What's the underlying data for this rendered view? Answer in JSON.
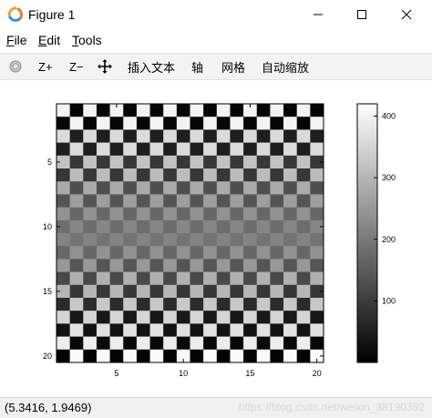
{
  "window": {
    "title": "Figure 1"
  },
  "menu": {
    "file": {
      "mnemonic": "F",
      "rest": "ile"
    },
    "edit": {
      "mnemonic": "E",
      "rest": "dit"
    },
    "tools": {
      "mnemonic": "T",
      "rest": "ools"
    }
  },
  "toolbar": {
    "zoom_in": "Z+",
    "zoom_out": "Z−",
    "insert_text": "插入文本",
    "axes": "轴",
    "grid": "网格",
    "autoscale": "自动缩放"
  },
  "status": {
    "coords": "(5.3416, 1.9469)",
    "watermark": "https://blog.csdn.net/weixin_38190382"
  },
  "colors": {
    "toolbar_bg": "#f3f3f3",
    "status_bg": "#f0f0f0"
  },
  "icons": [
    "octave-logo-icon",
    "minimize-icon",
    "maximize-icon",
    "close-icon",
    "rotate-icon",
    "pan-icon"
  ],
  "chart_data": {
    "type": "heatmap",
    "colormap": "gray",
    "title": "",
    "xlabel": "",
    "ylabel": "",
    "xlim": [
      0.5,
      20.5
    ],
    "ylim": [
      0.5,
      20.5
    ],
    "y_reversed": true,
    "x_ticks": [
      5,
      10,
      15,
      20
    ],
    "y_ticks": [
      5,
      10,
      15,
      20
    ],
    "colorbar": {
      "range": [
        0,
        420
      ],
      "ticks": [
        100,
        200,
        300,
        400
      ]
    },
    "grid": false,
    "values": [
      [
        400,
        10,
        400,
        10,
        400,
        10,
        400,
        10,
        400,
        10,
        400,
        10,
        400,
        10,
        400,
        10,
        400,
        10,
        400,
        10
      ],
      [
        10,
        400,
        10,
        400,
        10,
        400,
        10,
        400,
        10,
        400,
        10,
        400,
        10,
        400,
        10,
        400,
        10,
        400,
        10,
        400
      ],
      [
        360,
        50,
        360,
        50,
        360,
        50,
        360,
        50,
        360,
        50,
        360,
        50,
        360,
        50,
        360,
        50,
        360,
        50,
        360,
        50
      ],
      [
        50,
        360,
        50,
        360,
        50,
        360,
        50,
        360,
        50,
        360,
        50,
        360,
        50,
        360,
        50,
        360,
        50,
        360,
        50,
        360
      ],
      [
        320,
        90,
        320,
        90,
        320,
        90,
        320,
        90,
        320,
        90,
        320,
        90,
        320,
        90,
        320,
        90,
        320,
        90,
        320,
        90
      ],
      [
        90,
        310,
        90,
        310,
        90,
        310,
        90,
        310,
        90,
        310,
        90,
        310,
        90,
        310,
        90,
        310,
        90,
        310,
        90,
        310
      ],
      [
        280,
        130,
        280,
        130,
        280,
        130,
        280,
        130,
        280,
        130,
        280,
        130,
        280,
        130,
        280,
        130,
        280,
        130,
        280,
        130
      ],
      [
        140,
        260,
        140,
        260,
        140,
        260,
        140,
        260,
        140,
        260,
        140,
        260,
        140,
        260,
        140,
        260,
        140,
        260,
        140,
        260
      ],
      [
        240,
        170,
        240,
        170,
        240,
        170,
        240,
        170,
        240,
        170,
        240,
        170,
        240,
        170,
        240,
        170,
        240,
        170,
        240,
        170
      ],
      [
        180,
        220,
        180,
        220,
        180,
        220,
        180,
        220,
        180,
        220,
        180,
        220,
        180,
        220,
        180,
        220,
        180,
        220,
        180,
        220
      ],
      [
        215,
        190,
        215,
        190,
        215,
        190,
        215,
        190,
        215,
        190,
        215,
        190,
        215,
        190,
        215,
        190,
        215,
        190,
        215,
        190
      ],
      [
        170,
        240,
        170,
        240,
        170,
        240,
        170,
        240,
        170,
        240,
        170,
        240,
        170,
        240,
        170,
        240,
        170,
        240,
        170,
        240
      ],
      [
        250,
        140,
        250,
        140,
        250,
        140,
        250,
        140,
        250,
        140,
        250,
        140,
        250,
        140,
        250,
        140,
        250,
        140,
        250,
        140
      ],
      [
        120,
        290,
        120,
        290,
        120,
        290,
        120,
        290,
        120,
        290,
        120,
        290,
        120,
        290,
        120,
        290,
        120,
        290,
        120,
        290
      ],
      [
        300,
        90,
        300,
        90,
        300,
        90,
        300,
        90,
        300,
        90,
        300,
        90,
        300,
        90,
        300,
        90,
        300,
        90,
        300,
        90
      ],
      [
        70,
        330,
        70,
        330,
        70,
        330,
        70,
        330,
        70,
        330,
        70,
        330,
        70,
        330,
        70,
        330,
        70,
        330,
        70,
        330
      ],
      [
        350,
        40,
        350,
        40,
        350,
        40,
        350,
        40,
        350,
        40,
        350,
        40,
        350,
        40,
        350,
        40,
        350,
        40,
        350,
        40
      ],
      [
        30,
        370,
        30,
        370,
        30,
        370,
        30,
        370,
        30,
        370,
        30,
        370,
        30,
        370,
        30,
        370,
        30,
        370,
        30,
        370
      ],
      [
        390,
        15,
        390,
        15,
        390,
        15,
        390,
        15,
        390,
        15,
        390,
        15,
        390,
        15,
        390,
        15,
        390,
        15,
        390,
        15
      ],
      [
        5,
        410,
        5,
        410,
        5,
        410,
        5,
        410,
        5,
        410,
        5,
        410,
        5,
        410,
        5,
        410,
        5,
        410,
        5,
        410
      ]
    ]
  }
}
